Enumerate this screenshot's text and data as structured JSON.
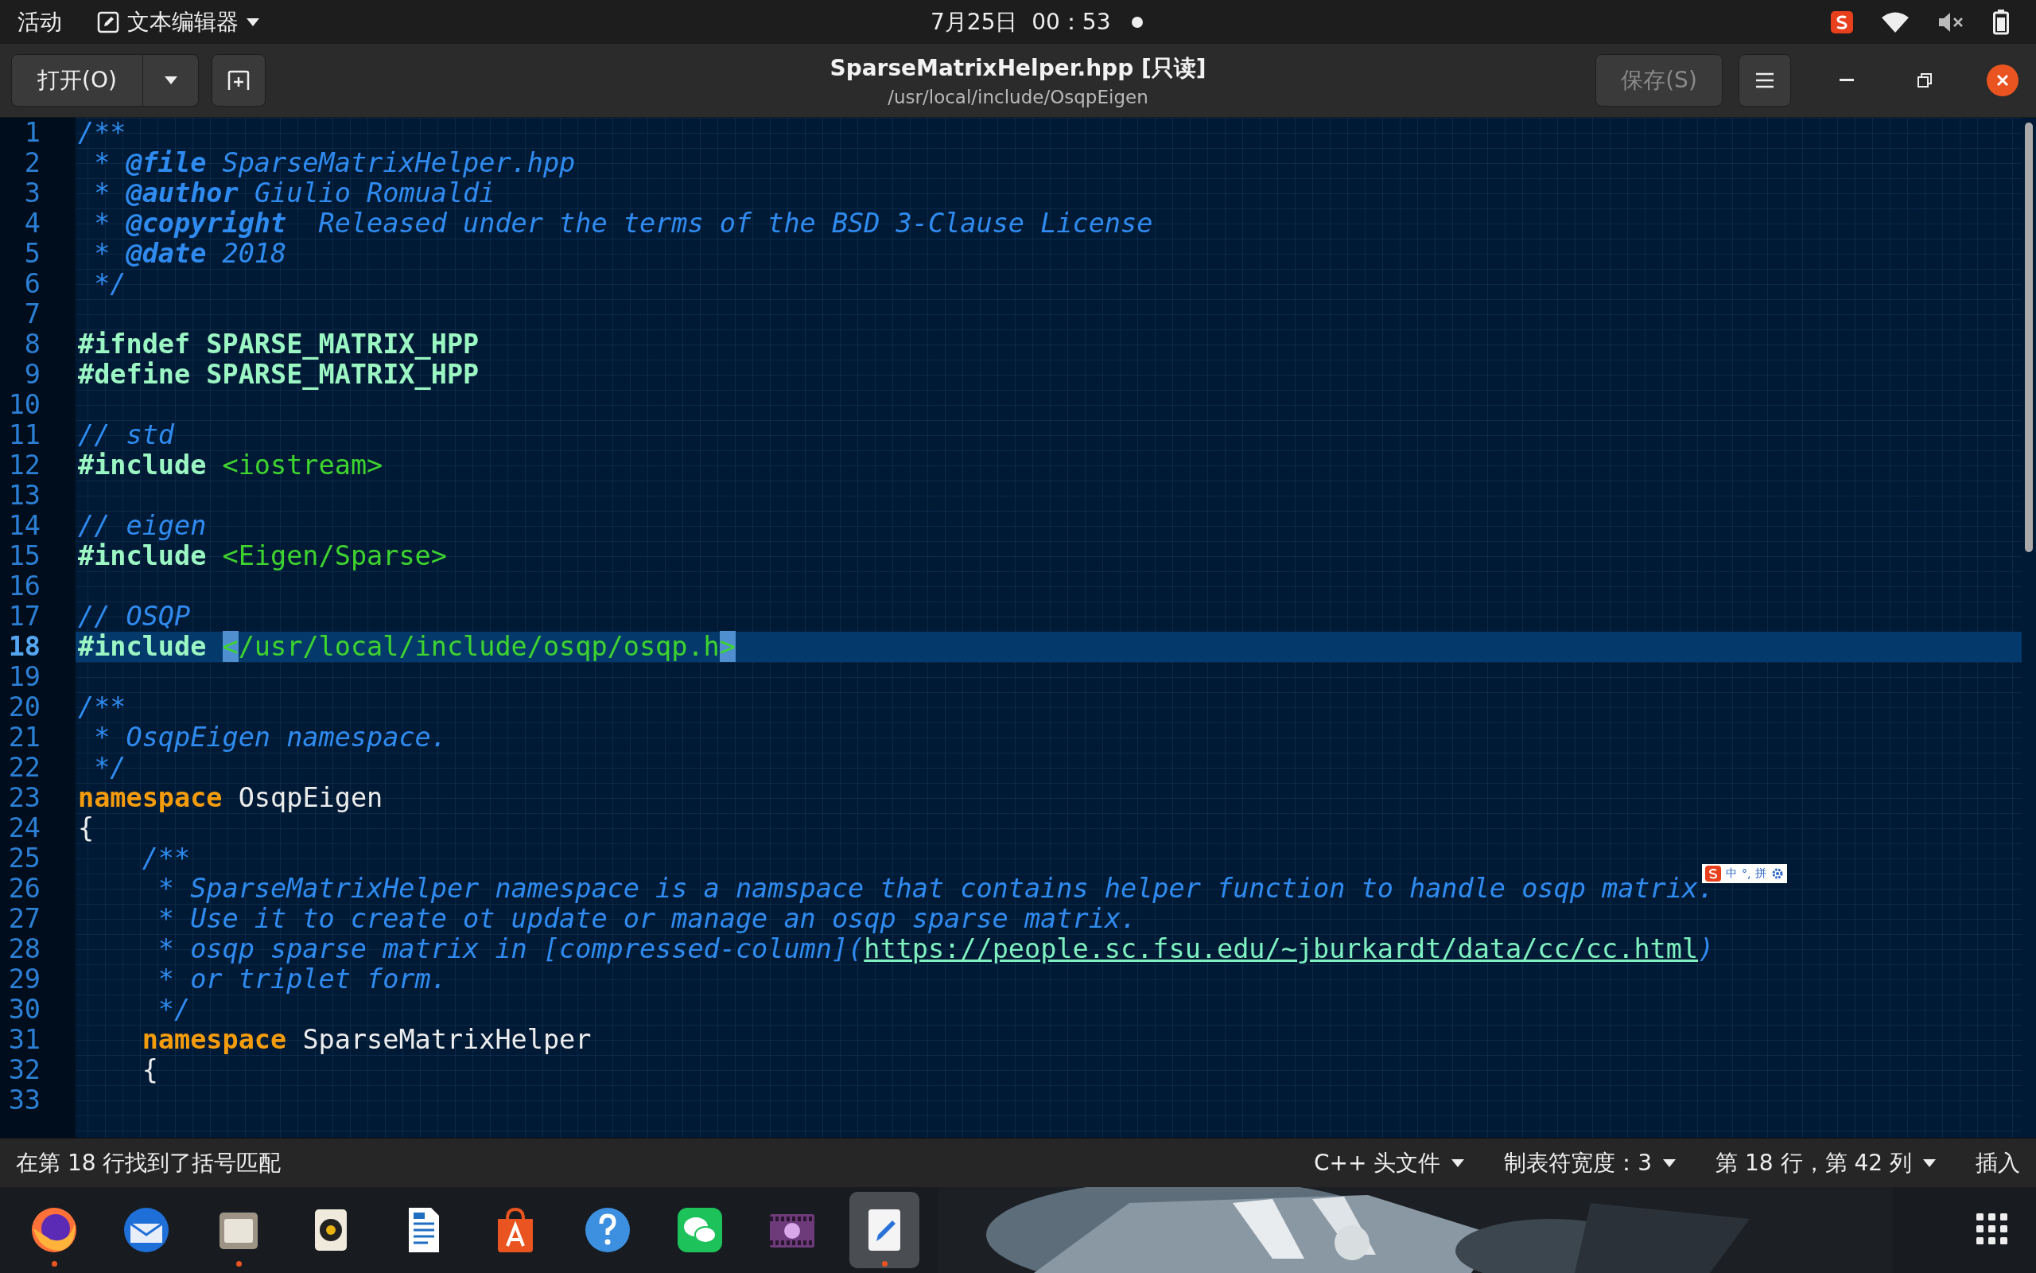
{
  "top_bar": {
    "activities": "活动",
    "app_menu": {
      "label": "文本编辑器"
    },
    "clock": "7月25日  00：53"
  },
  "header": {
    "open_button": "打开(O)",
    "title": "SparseMatrixHelper.hpp [只读]",
    "subtitle": "/usr/local/include/OsqpEigen",
    "save_button": {
      "label": "保存(S)",
      "disabled": true
    }
  },
  "editor": {
    "lines": [
      {
        "number": "1",
        "current": false,
        "tokens": [
          {
            "kind": "comment",
            "text": "/**"
          }
        ]
      },
      {
        "number": "2",
        "current": false,
        "tokens": [
          {
            "kind": "comment",
            "text": " * "
          },
          {
            "kind": "tag",
            "text": "@file"
          },
          {
            "kind": "comment",
            "text": " SparseMatrixHelper.hpp"
          }
        ]
      },
      {
        "number": "3",
        "current": false,
        "tokens": [
          {
            "kind": "comment",
            "text": " * "
          },
          {
            "kind": "tag",
            "text": "@author"
          },
          {
            "kind": "comment",
            "text": " Giulio Romualdi"
          }
        ]
      },
      {
        "number": "4",
        "current": false,
        "tokens": [
          {
            "kind": "comment",
            "text": " * "
          },
          {
            "kind": "tag",
            "text": "@copyright"
          },
          {
            "kind": "comment",
            "text": "  Released under the terms of the BSD 3-Clause License"
          }
        ]
      },
      {
        "number": "5",
        "current": false,
        "tokens": [
          {
            "kind": "comment",
            "text": " * "
          },
          {
            "kind": "tag",
            "text": "@date"
          },
          {
            "kind": "comment",
            "text": " 2018"
          }
        ]
      },
      {
        "number": "6",
        "current": false,
        "tokens": [
          {
            "kind": "comment",
            "text": " */"
          }
        ]
      },
      {
        "number": "7",
        "current": false
      },
      {
        "number": "8",
        "current": false,
        "tokens": [
          {
            "kind": "preproc",
            "text": "#ifndef SPARSE_MATRIX_HPP"
          }
        ]
      },
      {
        "number": "9",
        "current": false,
        "tokens": [
          {
            "kind": "preproc",
            "text": "#define SPARSE_MATRIX_HPP"
          }
        ]
      },
      {
        "number": "10",
        "current": false
      },
      {
        "number": "11",
        "current": false,
        "tokens": [
          {
            "kind": "comment",
            "text": "// std"
          }
        ]
      },
      {
        "number": "12",
        "current": false,
        "tokens": [
          {
            "kind": "preproc",
            "text": "#include"
          },
          {
            "kind": "string",
            "text": " <iostream>"
          }
        ]
      },
      {
        "number": "13",
        "current": false
      },
      {
        "number": "14",
        "current": false,
        "tokens": [
          {
            "kind": "comment",
            "text": "// eigen"
          }
        ]
      },
      {
        "number": "15",
        "current": false,
        "tokens": [
          {
            "kind": "preproc",
            "text": "#include"
          },
          {
            "kind": "string",
            "text": " <Eigen/Sparse>"
          }
        ]
      },
      {
        "number": "16",
        "current": false
      },
      {
        "number": "17",
        "current": false,
        "tokens": [
          {
            "kind": "comment",
            "text": "// OSQP"
          }
        ]
      },
      {
        "number": "18",
        "current": true,
        "tokens": [
          {
            "kind": "preproc",
            "text": "#include"
          },
          {
            "kind": "match",
            "text": " <"
          },
          {
            "kind": "string",
            "text": "/usr/local/include/osqp/osqp.h"
          },
          {
            "kind": "match",
            "text": ">"
          }
        ]
      },
      {
        "number": "19",
        "current": false
      },
      {
        "number": "20",
        "current": false,
        "tokens": [
          {
            "kind": "comment",
            "text": "/**"
          }
        ]
      },
      {
        "number": "21",
        "current": false,
        "tokens": [
          {
            "kind": "comment",
            "text": " * OsqpEigen namespace."
          }
        ]
      },
      {
        "number": "22",
        "current": false,
        "tokens": [
          {
            "kind": "comment",
            "text": " */"
          }
        ]
      },
      {
        "number": "23",
        "current": false,
        "tokens": [
          {
            "kind": "keyword",
            "text": "namespace"
          },
          {
            "kind": "plain",
            "text": " OsqpEigen"
          }
        ]
      },
      {
        "number": "24",
        "current": false,
        "tokens": [
          {
            "kind": "plain",
            "text": "{"
          }
        ]
      },
      {
        "number": "25",
        "current": false,
        "tokens": [
          {
            "kind": "comment",
            "text": "    /**"
          }
        ]
      },
      {
        "number": "26",
        "current": false,
        "tokens": [
          {
            "kind": "comment",
            "text": "     * SparseMatrixHelper namespace is a namspace that contains helper function to handle osqp matrix."
          }
        ]
      },
      {
        "number": "27",
        "current": false,
        "tokens": [
          {
            "kind": "comment",
            "text": "     * Use it to create ot update or manage an osqp sparse matrix."
          }
        ]
      },
      {
        "number": "28",
        "current": false,
        "tokens": [
          {
            "kind": "comment",
            "text": "     * osqp sparse matrix in [compressed-column]("
          },
          {
            "kind": "link",
            "text": "https://people.sc.fsu.edu/~jburkardt/data/cc/cc.html"
          },
          {
            "kind": "comment",
            "text": ")"
          }
        ]
      },
      {
        "number": "29",
        "current": false,
        "tokens": [
          {
            "kind": "comment",
            "text": "     * or triplet form."
          }
        ]
      },
      {
        "number": "30",
        "current": false,
        "tokens": [
          {
            "kind": "comment",
            "text": "     */"
          }
        ]
      },
      {
        "number": "31",
        "current": false,
        "tokens": [
          {
            "kind": "keyword",
            "text": "    namespace"
          },
          {
            "kind": "plain",
            "text": " SparseMatrixHelper"
          }
        ]
      },
      {
        "number": "32",
        "current": false,
        "tokens": [
          {
            "kind": "plain",
            "text": "    {"
          }
        ]
      },
      {
        "number": "33",
        "current": false
      }
    ]
  },
  "ime_toolbar": {
    "items": [
      "中",
      "°,",
      "拼"
    ]
  },
  "status_bar": {
    "message": "在第 18 行找到了括号匹配",
    "language": "C++ 头文件",
    "tab_width": "制表符宽度：3",
    "position": "第 18 行，第 42 列",
    "mode": "插入"
  },
  "dock": {
    "apps": [
      {
        "kind": "firefox",
        "running": true,
        "selected": false
      },
      {
        "kind": "mail",
        "running": false,
        "selected": false
      },
      {
        "kind": "files",
        "running": true,
        "selected": false
      },
      {
        "kind": "music",
        "running": false,
        "selected": false
      },
      {
        "kind": "writer",
        "running": false,
        "selected": false
      },
      {
        "kind": "store",
        "running": false,
        "selected": false
      },
      {
        "kind": "help",
        "running": false,
        "selected": false
      },
      {
        "kind": "chat",
        "running": false,
        "selected": false
      },
      {
        "kind": "video",
        "running": false,
        "selected": false
      },
      {
        "kind": "editor",
        "running": true,
        "selected": true
      }
    ]
  }
}
